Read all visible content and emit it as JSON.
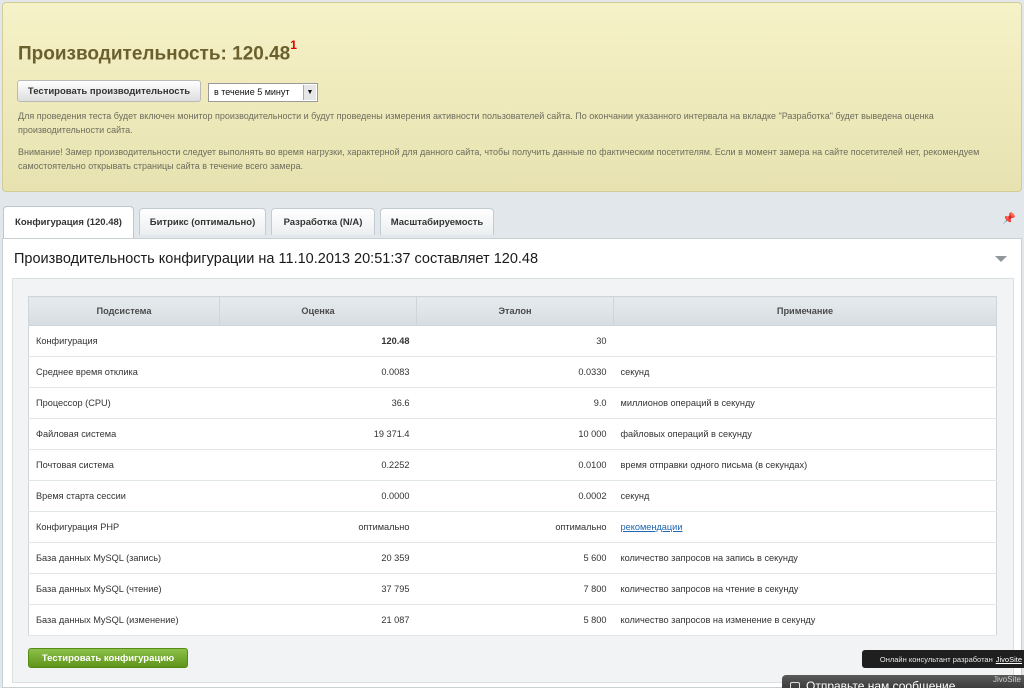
{
  "banner": {
    "title": "Производительность: 120.48",
    "title_sup": "1",
    "test_button": "Тестировать производительность",
    "duration_select": "в течение 5 минут",
    "info_text": "Для проведения теста будет включен монитор производительности и будут проведены измерения активности пользователей сайта. По окончании указанного интервала на вкладке \"Разработка\" будет выведена оценка производительности сайта.",
    "warning_text": "Внимание! Замер производительности следует выполнять во время нагрузки, характерной для данного сайта, чтобы получить данные по фактическим посетителям. Если в момент замера на сайте посетителей нет, рекомендуем самостоятельно открывать страницы сайта в течение всего замера."
  },
  "tabs": [
    {
      "label": "Конфигурация (120.48)",
      "active": true
    },
    {
      "label": "Битрикс (оптимально)",
      "active": false
    },
    {
      "label": "Разработка (N/A)",
      "active": false
    },
    {
      "label": "Масштабируемость",
      "active": false
    }
  ],
  "panel": {
    "title": "Производительность конфигурации на 11.10.2013 20:51:37 составляет 120.48",
    "columns": [
      "Подсистема",
      "Оценка",
      "Эталон",
      "Примечание"
    ],
    "rows": [
      {
        "name": "Конфигурация",
        "score": "120.48",
        "reference": "30",
        "note": "",
        "bold": true
      },
      {
        "name": "Среднее время отклика",
        "score": "0.0083",
        "reference": "0.0330",
        "note": "секунд"
      },
      {
        "name": "Процессор (CPU)",
        "score": "36.6",
        "reference": "9.0",
        "note": "миллионов операций в секунду"
      },
      {
        "name": "Файловая система",
        "score": "19 371.4",
        "reference": "10 000",
        "note": "файловых операций в секунду"
      },
      {
        "name": "Почтовая система",
        "score": "0.2252",
        "reference": "0.0100",
        "note": "время отправки одного письма (в секундах)"
      },
      {
        "name": "Время старта сессии",
        "score": "0.0000",
        "reference": "0.0002",
        "note": "секунд"
      },
      {
        "name": "Конфигурация PHP",
        "score": "оптимально",
        "reference": "оптимально",
        "note": "рекомендации",
        "note_link": true
      },
      {
        "name": "База данных MySQL (запись)",
        "score": "20 359",
        "reference": "5 600",
        "note": "количество запросов на запись в секунду"
      },
      {
        "name": "База данных MySQL (чтение)",
        "score": "37 795",
        "reference": "7 800",
        "note": "количество запросов на чтение в секунду"
      },
      {
        "name": "База данных MySQL (изменение)",
        "score": "21 087",
        "reference": "5 800",
        "note": "количество запросов на изменение в секунду"
      }
    ],
    "action_button": "Тестировать конфигурацию"
  },
  "jivo": {
    "tooltip_text": "Онлайн консультант разработан",
    "tooltip_link": "JivoSite",
    "bar_text": "Отправьте нам сообщение",
    "brand": "JivoSite"
  },
  "colors": {
    "banner_bg": "#f2eec0",
    "title_color": "#6b5f2d",
    "accent_red": "#e00000",
    "green_button": "#6fa62a",
    "link": "#2067b0"
  },
  "icons": {
    "pin": "pin-icon",
    "collapse": "chevron-down-icon",
    "select_arrow": "dropdown-arrow-icon"
  }
}
